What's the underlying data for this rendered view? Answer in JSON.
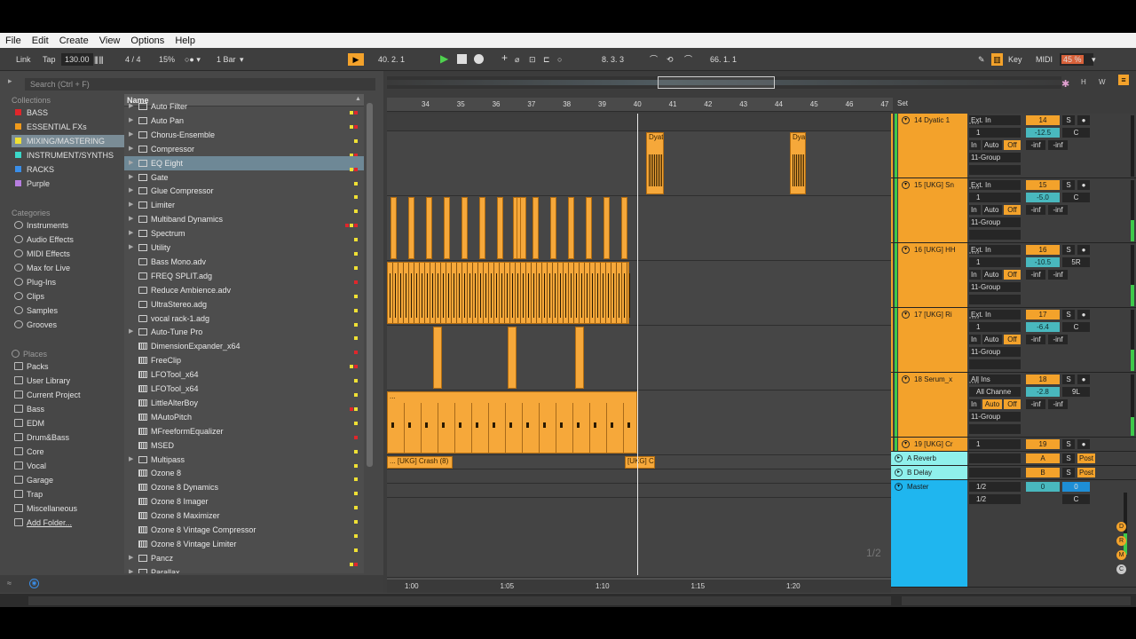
{
  "menu": [
    "File",
    "Edit",
    "Create",
    "View",
    "Options",
    "Help"
  ],
  "toolbar": {
    "link": "Link",
    "tap": "Tap",
    "tempo": "130.00",
    "signature": "4 / 4",
    "swing": "15%",
    "quantize": "1 Bar",
    "position": "40.  2.  1",
    "loop_start": "8.  3.  3",
    "loop_length": "66.  1.  1",
    "key": "Key",
    "midi": "MIDI",
    "cpu": "45 %",
    "h_btn": "H",
    "w_btn": "W"
  },
  "browser": {
    "search_placeholder": "Search (Ctrl + F)",
    "collections_header": "Collections",
    "collections": [
      {
        "label": "BASS",
        "color": "#e0262b"
      },
      {
        "label": "ESSENTIAL FXs",
        "color": "#f09a1b"
      },
      {
        "label": "MIXING/MASTERING",
        "color": "#efe034"
      },
      {
        "label": "INSTRUMENT/SYNTHS",
        "color": "#3bd8c9"
      },
      {
        "label": "RACKS",
        "color": "#3a8ee8"
      },
      {
        "label": "Purple",
        "color": "#b77ee0"
      }
    ],
    "categories_header": "Categories",
    "categories": [
      "Instruments",
      "Audio Effects",
      "MIDI Effects",
      "Max for Live",
      "Plug-Ins",
      "Clips",
      "Samples",
      "Grooves"
    ],
    "places_header": "Places",
    "places": [
      "Packs",
      "User Library",
      "Current Project",
      "Bass",
      "EDM",
      "Drum&Bass",
      "Core",
      "Vocal",
      "Garage",
      "Trap",
      "Miscellaneous",
      "Add Folder..."
    ],
    "column_header": "Name",
    "files": [
      {
        "name": "Auto Filter",
        "type": "folder",
        "dots": [
          "#efe034",
          "#e0262b"
        ]
      },
      {
        "name": "Auto Pan",
        "type": "folder",
        "dots": [
          "#efe034",
          "#e0262b"
        ]
      },
      {
        "name": "Chorus-Ensemble",
        "type": "folder",
        "dots": [
          "#efe034"
        ]
      },
      {
        "name": "Compressor",
        "type": "folder",
        "dots": [
          "#efe034",
          "#e0262b"
        ]
      },
      {
        "name": "EQ Eight",
        "type": "folder",
        "dots": [
          "#efe034",
          "#e0262b"
        ],
        "selected": true
      },
      {
        "name": "Gate",
        "type": "folder",
        "dots": [
          "#efe034"
        ]
      },
      {
        "name": "Glue Compressor",
        "type": "folder",
        "dots": [
          "#efe034"
        ]
      },
      {
        "name": "Limiter",
        "type": "folder",
        "dots": [
          "#efe034"
        ]
      },
      {
        "name": "Multiband Dynamics",
        "type": "folder",
        "dots": [
          "#e0262b",
          "#efe034",
          "#e0262b"
        ]
      },
      {
        "name": "Spectrum",
        "type": "folder",
        "dots": [
          "#efe034"
        ]
      },
      {
        "name": "Utility",
        "type": "folder",
        "dots": [
          "#efe034"
        ]
      },
      {
        "name": "Bass Mono.adv",
        "type": "file",
        "dots": [
          "#efe034"
        ]
      },
      {
        "name": "FREQ SPLIT.adg",
        "type": "file",
        "dots": [
          "#e0262b"
        ]
      },
      {
        "name": "Reduce Ambience.adv",
        "type": "file",
        "dots": [
          "#efe034"
        ]
      },
      {
        "name": "UltraStereo.adg",
        "type": "file",
        "dots": [
          "#efe034"
        ]
      },
      {
        "name": "vocal rack-1.adg",
        "type": "file",
        "dots": [
          "#efe034"
        ]
      },
      {
        "name": "Auto-Tune Pro",
        "type": "folder",
        "dots": [
          "#efe034"
        ]
      },
      {
        "name": "DimensionExpander_x64",
        "type": "plugin",
        "dots": [
          "#e0262b"
        ]
      },
      {
        "name": "FreeClip",
        "type": "plugin",
        "dots": [
          "#efe034",
          "#e0262b"
        ]
      },
      {
        "name": "LFOTool_x64",
        "type": "plugin",
        "dots": [
          "#efe034"
        ]
      },
      {
        "name": "LFOTool_x64",
        "type": "plugin",
        "dots": [
          "#efe034"
        ]
      },
      {
        "name": "LittleAlterBoy",
        "type": "plugin",
        "dots": [
          "#e0262b",
          "#efe034"
        ]
      },
      {
        "name": "MAutoPitch",
        "type": "plugin",
        "dots": [
          "#efe034"
        ]
      },
      {
        "name": "MFreeformEqualizer",
        "type": "plugin",
        "dots": [
          "#e0262b"
        ]
      },
      {
        "name": "MSED",
        "type": "plugin",
        "dots": [
          "#efe034"
        ]
      },
      {
        "name": "Multipass",
        "type": "folder",
        "dots": [
          "#efe034"
        ]
      },
      {
        "name": "Ozone 8",
        "type": "plugin",
        "dots": [
          "#efe034"
        ]
      },
      {
        "name": "Ozone 8 Dynamics",
        "type": "plugin",
        "dots": [
          "#efe034"
        ]
      },
      {
        "name": "Ozone 8 Imager",
        "type": "plugin",
        "dots": [
          "#efe034"
        ]
      },
      {
        "name": "Ozone 8 Maximizer",
        "type": "plugin",
        "dots": [
          "#efe034"
        ]
      },
      {
        "name": "Ozone 8 Vintage Compressor",
        "type": "plugin",
        "dots": [
          "#efe034"
        ]
      },
      {
        "name": "Ozone 8 Vintage Limiter",
        "type": "plugin",
        "dots": [
          "#efe034"
        ]
      },
      {
        "name": "Pancz",
        "type": "folder",
        "dots": [
          "#efe034",
          "#e0262b"
        ]
      },
      {
        "name": "Parallax",
        "type": "folder",
        "dots": [
          "#efe034",
          "#e0262b"
        ]
      }
    ]
  },
  "arrangement": {
    "bars": [
      "34",
      "35",
      "36",
      "37",
      "38",
      "39",
      "40",
      "41",
      "42",
      "43",
      "44",
      "45",
      "46",
      "47"
    ],
    "time_marks": [
      "1:00",
      "1:05",
      "1:10",
      "1:15",
      "1:20"
    ],
    "set_label": "Set",
    "page_indicator": "1/2",
    "clip_labels": {
      "dyatic_a": "Dyat",
      "dyatic_b": "Dya",
      "serum": "...",
      "crash_a": "... [UKG] Crash (8)",
      "crash_b": "[UKG] C"
    }
  },
  "tracks": [
    {
      "name": "14 Dyatic 1",
      "input": "Ext. In",
      "channel": "1",
      "num": "14",
      "vol": "-12.5",
      "pan": "C",
      "route": "11-Group",
      "peak1": "-inf",
      "peak2": "-inf",
      "auto_off": "Off"
    },
    {
      "name": "15 [UKG] Sn",
      "input": "Ext. In",
      "channel": "1",
      "num": "15",
      "vol": "-5.0",
      "pan": "C",
      "route": "11-Group",
      "peak1": "-inf",
      "peak2": "-inf",
      "auto_off": "Off"
    },
    {
      "name": "16 [UKG] HH",
      "input": "Ext. In",
      "channel": "1",
      "num": "16",
      "vol": "-10.5",
      "pan": "5R",
      "route": "11-Group",
      "peak1": "-inf",
      "peak2": "-inf",
      "auto_off": "Off"
    },
    {
      "name": "17 [UKG] Ri",
      "input": "Ext. In",
      "channel": "1",
      "num": "17",
      "vol": "-6.4",
      "pan": "C",
      "route": "11-Group",
      "peak1": "-inf",
      "peak2": "-inf",
      "auto_off": "Off"
    },
    {
      "name": "18 Serum_x",
      "input": "All Ins",
      "channel": "All Channe",
      "num": "18",
      "vol": "-2.8",
      "pan": "9L",
      "route": "11-Group",
      "peak1": "-inf",
      "peak2": "-inf",
      "auto_off": "Off"
    },
    {
      "name": "19 [UKG] Cr",
      "input": "1",
      "num": "19"
    }
  ],
  "labels": {
    "in": "In",
    "auto": "Auto",
    "s": "S",
    "post": "Post"
  },
  "returns": [
    {
      "name": "A Reverb",
      "letter": "A"
    },
    {
      "name": "B Delay",
      "letter": "B"
    }
  ],
  "master": {
    "name": "Master",
    "out1": "1/2",
    "out2": "1/2",
    "vol": "0",
    "vol2": "0",
    "pan": "C"
  },
  "side_buttons": [
    "D",
    "R",
    "M",
    "C"
  ]
}
